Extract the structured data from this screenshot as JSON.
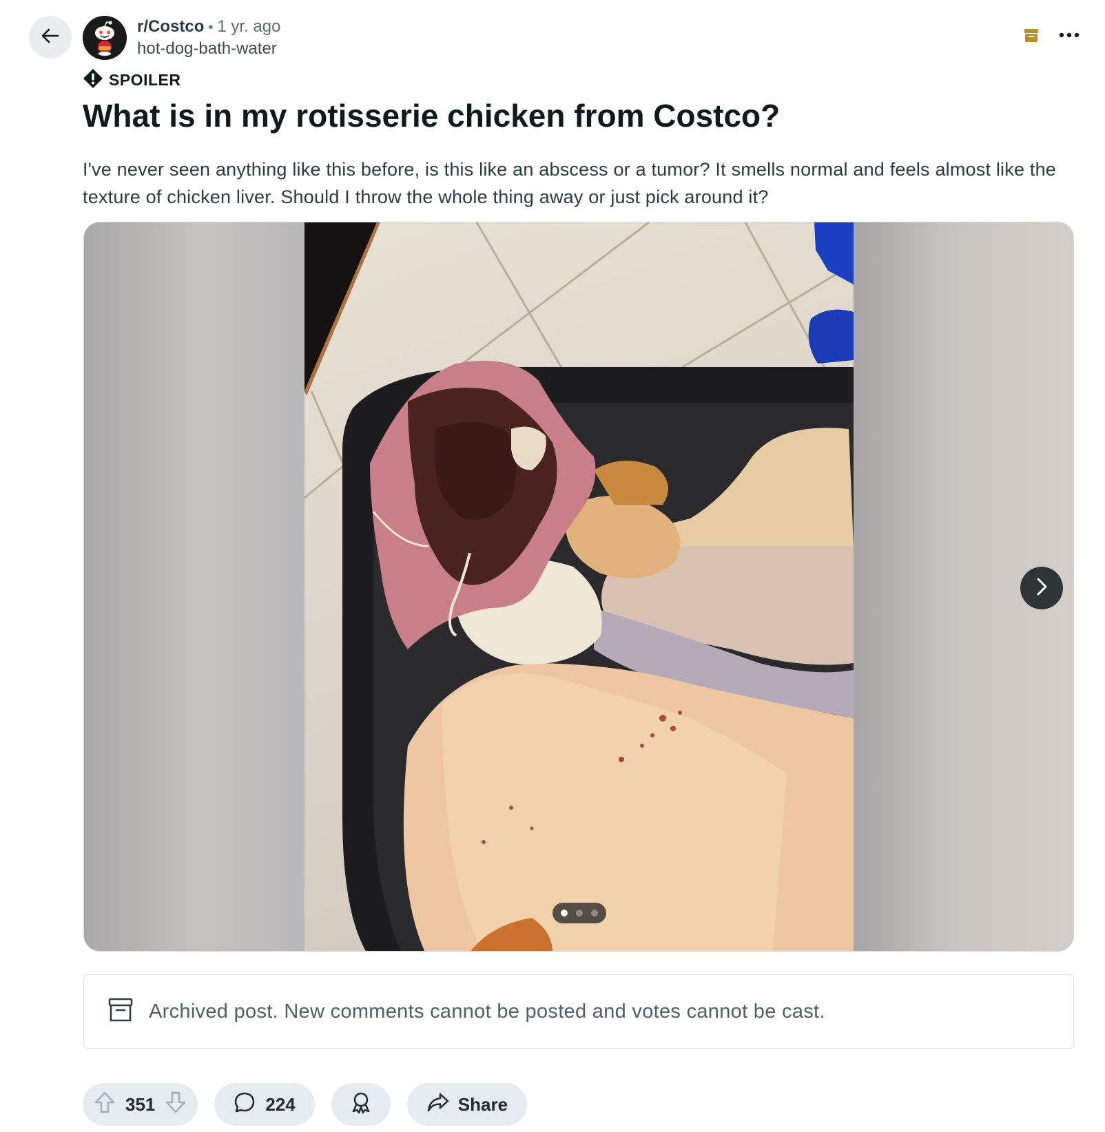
{
  "header": {
    "subreddit": "r/Costco",
    "separator": "•",
    "time_ago": "1 yr. ago",
    "author": "hot-dog-bath-water"
  },
  "icons": {
    "back": "arrow-left-icon",
    "archive": "archive-icon",
    "more": "more-horizontal-icon",
    "spoiler": "spoiler-alert-icon",
    "next": "chevron-right-icon",
    "upvote": "upvote-arrow-icon",
    "downvote": "downvote-arrow-icon",
    "comment": "comment-bubble-icon",
    "award": "award-icon",
    "share": "share-arrow-icon"
  },
  "post": {
    "spoiler_label": "SPOILER",
    "title": "What is in my rotisserie chicken from Costco?",
    "body": "I've never seen anything like this before, is this like an abscess or a tumor? It smells normal and feels almost like the texture of chicken liver. Should I throw the whole thing away or just pick around it?"
  },
  "gallery": {
    "image_count": 3,
    "current_index": 1
  },
  "archived_notice": "Archived post. New comments cannot be posted and votes cannot be cast.",
  "actions": {
    "votes": "351",
    "comments": "224",
    "share_label": "Share"
  },
  "colors": {
    "archive_accent": "#b8902c",
    "pill_bg": "#e5ebee",
    "text_primary": "#0f1a1c",
    "text_secondary": "#5c6c74"
  }
}
